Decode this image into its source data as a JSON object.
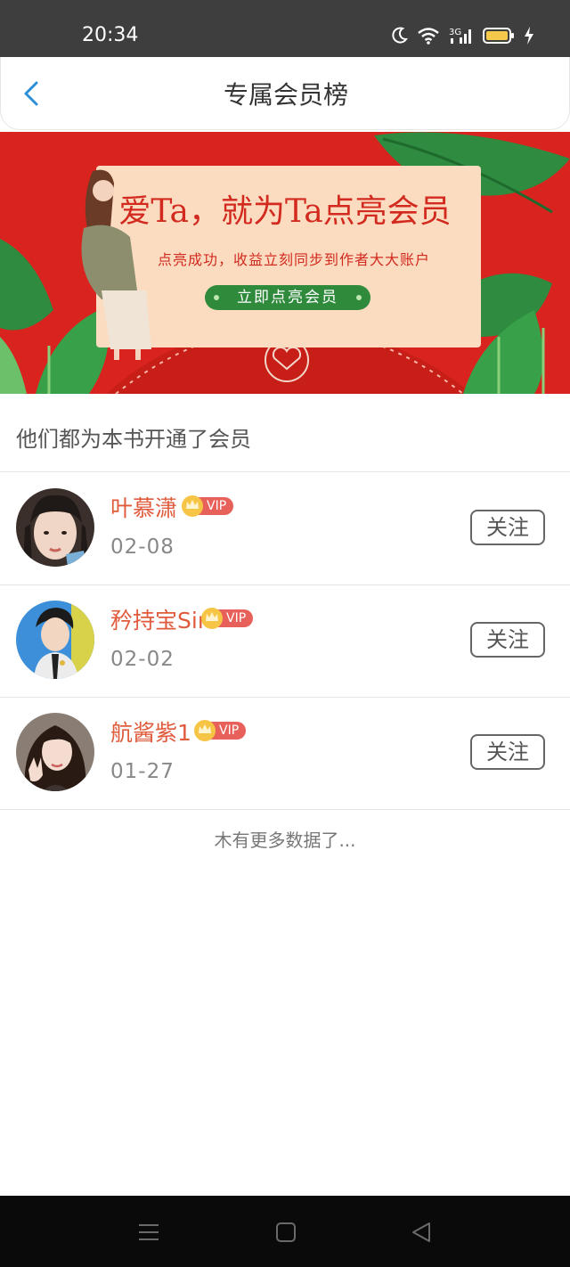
{
  "status_bar": {
    "time": "20:34",
    "network_label": "3G",
    "icons": [
      "moon-icon",
      "wifi-icon",
      "signal-icon",
      "battery-icon",
      "charging-icon"
    ]
  },
  "nav": {
    "title": "专属会员榜",
    "back_icon": "chevron-left-icon"
  },
  "banner": {
    "headline": "爱Ta，就为Ta点亮会员",
    "subtitle": "点亮成功，收益立刻同步到作者大大账户",
    "cta_label": "立即点亮会员"
  },
  "list": {
    "section_title": "他们都为本书开通了会员",
    "members": [
      {
        "name": "叶慕潇",
        "badge": "VIP",
        "date": "02-08",
        "follow_label": "关注"
      },
      {
        "name": "矜持宝Sir",
        "badge": "VIP",
        "date": "02-02",
        "follow_label": "关注"
      },
      {
        "name": "航酱紫1",
        "badge": "VIP",
        "date": "01-27",
        "follow_label": "关注"
      }
    ],
    "end_text": "木有更多数据了..."
  },
  "system_nav": {
    "icons": [
      "menu-icon",
      "home-icon",
      "back-icon"
    ]
  },
  "colors": {
    "status_bar": "#3e3e3e",
    "banner_red": "#d8231e",
    "member_name": "#e05a3c",
    "vip_badge": "#e8605a",
    "back_arrow": "#2a8fd8"
  }
}
